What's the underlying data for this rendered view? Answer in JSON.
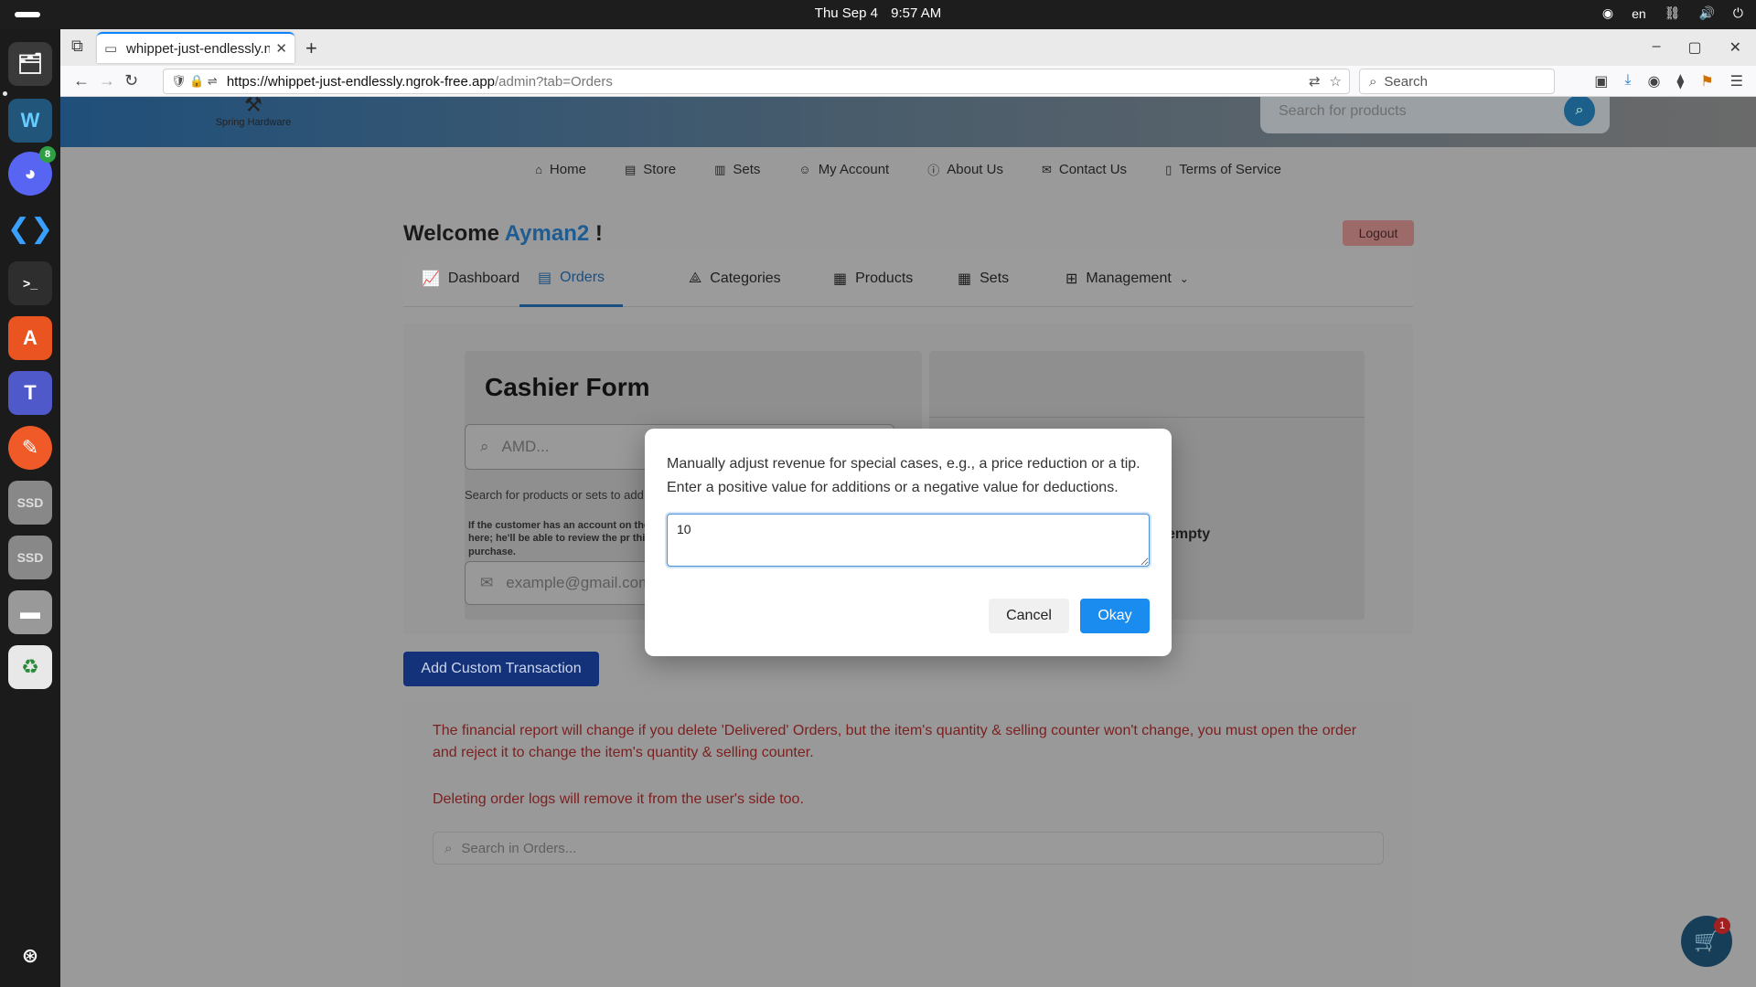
{
  "system": {
    "date": "Thu Sep 4",
    "time": "9:57 AM",
    "language": "en"
  },
  "dock": {
    "discord_badge": "8",
    "ssd1": "SSD",
    "ssd2": "SSD"
  },
  "browser": {
    "tab_title": "whippet-just-endlessly.ng",
    "url_host": "https://whippet-just-endlessly.ngrok-free.app",
    "url_path": "/admin?tab=Orders",
    "search_placeholder": "Search"
  },
  "site": {
    "logo_text": "Spring Hardware",
    "search_placeholder": "Search for products",
    "nav": [
      {
        "label": "Home"
      },
      {
        "label": "Store"
      },
      {
        "label": "Sets"
      },
      {
        "label": "My Account"
      },
      {
        "label": "About Us"
      },
      {
        "label": "Contact Us"
      },
      {
        "label": "Terms of Service"
      }
    ],
    "welcome_prefix": "Welcome",
    "username": "Ayman2",
    "welcome_suffix": "!",
    "logout_label": "Logout"
  },
  "admin_tabs": [
    {
      "label": "Dashboard"
    },
    {
      "label": "Orders"
    },
    {
      "label": "Categories"
    },
    {
      "label": "Products"
    },
    {
      "label": "Sets"
    },
    {
      "label": "Management"
    }
  ],
  "cashier": {
    "title": "Cashier Form",
    "product_placeholder": "AMD...",
    "search_help": "Search for products or sets to add",
    "customer_help": "If the customer has an account on the it here; he'll be able to review the pr this purchase.",
    "email_placeholder": "example@gmail.com",
    "cart_empty": "empty"
  },
  "custom_transaction_label": "Add Custom Transaction",
  "warnings": {
    "delivered": "The financial report will change if you delete 'Delivered' Orders, but the item's quantity & selling counter won't change, you must open the order and reject it to change the item's quantity & selling counter.",
    "logs": "Deleting order logs will remove it from the user's side too.",
    "orders_search_placeholder": "Search in Orders..."
  },
  "cart_count": "1",
  "modal": {
    "line1": "Manually adjust revenue for special cases, e.g., a price reduction or a tip.",
    "line2": "Enter a positive value for additions or a negative value for deductions.",
    "input_value": "10",
    "cancel_label": "Cancel",
    "okay_label": "Okay"
  },
  "colors": {
    "accent": "#1a8cf0",
    "brand_blue": "#1f5c92",
    "warning_red": "#c0392b"
  }
}
